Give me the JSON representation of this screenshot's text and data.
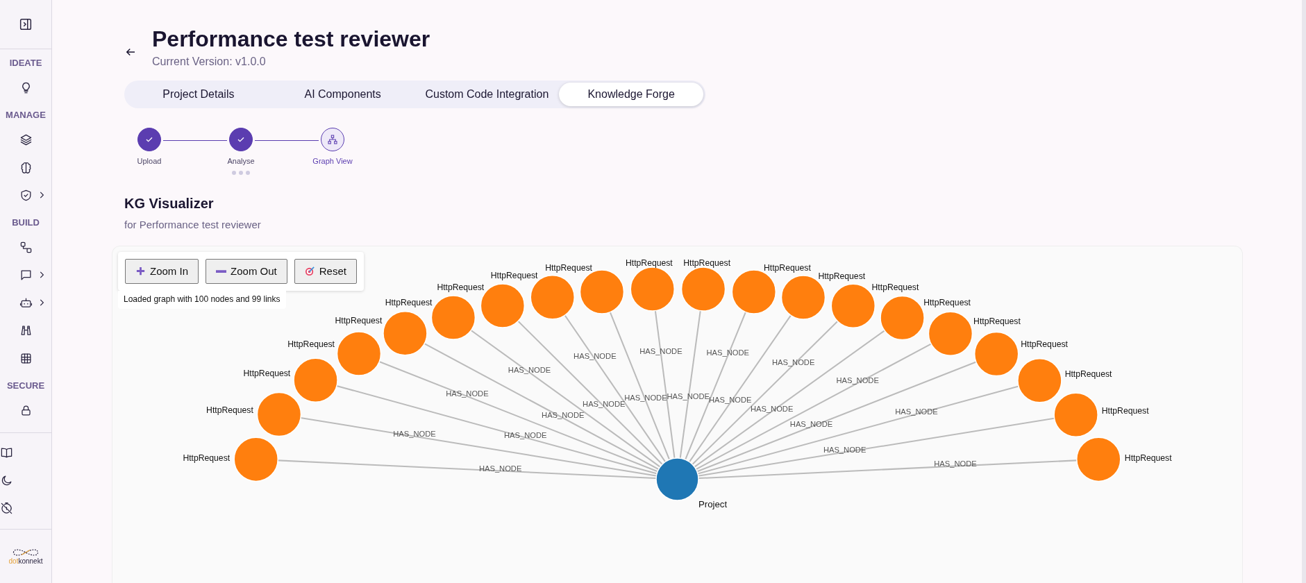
{
  "sidebar": {
    "sections": [
      {
        "label": "IDEATE",
        "items": [
          {
            "kind": "bulb",
            "expandable": false
          }
        ]
      },
      {
        "label": "MANAGE",
        "items": [
          {
            "kind": "layers",
            "expandable": false
          },
          {
            "kind": "brain",
            "expandable": false
          },
          {
            "kind": "shield",
            "expandable": true
          }
        ]
      },
      {
        "label": "BUILD",
        "items": [
          {
            "kind": "nodes",
            "expandable": false
          },
          {
            "kind": "chat",
            "expandable": true
          },
          {
            "kind": "robot",
            "expandable": true
          },
          {
            "kind": "binoculars",
            "expandable": false
          },
          {
            "kind": "grid",
            "expandable": false
          }
        ]
      },
      {
        "label": "SECURE",
        "items": [
          {
            "kind": "lock",
            "expandable": false
          }
        ]
      }
    ],
    "bottom_items": [
      {
        "kind": "book"
      },
      {
        "kind": "moon"
      },
      {
        "kind": "timer-off"
      }
    ],
    "logo": {
      "part_1": "dot",
      "part_2": "konnekt"
    }
  },
  "header": {
    "title": "Performance test reviewer",
    "subtitle": "Current Version: v1.0.0"
  },
  "tabs": [
    {
      "label": "Project Details",
      "selected": false
    },
    {
      "label": "AI Components",
      "selected": false
    },
    {
      "label": "Custom Code Integration",
      "selected": false
    },
    {
      "label": "Knowledge Forge",
      "selected": true
    }
  ],
  "stepper": {
    "steps": [
      {
        "label": "Upload",
        "completed": true,
        "loading": false,
        "kind": "check"
      },
      {
        "label": "Analyse",
        "completed": true,
        "loading": true,
        "kind": "check"
      },
      {
        "label": "Graph View",
        "completed": false,
        "loading": false,
        "kind": "graph"
      }
    ]
  },
  "section": {
    "title": "KG Visualizer",
    "subtitle": "for Performance test reviewer"
  },
  "graph": {
    "toolbar": [
      {
        "label": "Zoom In",
        "kind": "plus"
      },
      {
        "label": "Zoom Out",
        "kind": "minus"
      },
      {
        "label": "Reset",
        "kind": "target"
      }
    ],
    "status": "Loaded graph with 100 nodes and 99 links",
    "root": {
      "label": "Project"
    },
    "children": [
      {
        "label": "HttpRequest",
        "link_label": "HAS_NODE"
      },
      {
        "label": "HttpRequest",
        "link_label": "HAS_NODE"
      },
      {
        "label": "HttpRequest",
        "link_label": "HAS_NODE"
      },
      {
        "label": "HttpRequest",
        "link_label": "HAS_NODE"
      },
      {
        "label": "HttpRequest",
        "link_label": "HAS_NODE"
      },
      {
        "label": "HttpRequest",
        "link_label": "HAS_NODE"
      },
      {
        "label": "HttpRequest",
        "link_label": "HAS_NODE"
      },
      {
        "label": "HttpRequest",
        "link_label": "HAS_NODE"
      },
      {
        "label": "HttpRequest",
        "link_label": "HAS_NODE"
      },
      {
        "label": "HttpRequest",
        "link_label": "HAS_NODE"
      },
      {
        "label": "HttpRequest",
        "link_label": "HAS_NODE"
      },
      {
        "label": "HttpRequest",
        "link_label": "HAS_NODE"
      },
      {
        "label": "HttpRequest",
        "link_label": "HAS_NODE"
      },
      {
        "label": "HttpRequest",
        "link_label": "HAS_NODE"
      },
      {
        "label": "HttpRequest",
        "link_label": "HAS_NODE"
      },
      {
        "label": "HttpRequest",
        "link_label": "HAS_NODE"
      },
      {
        "label": "HttpRequest",
        "link_label": "HAS_NODE"
      },
      {
        "label": "HttpRequest",
        "link_label": "HAS_NODE"
      },
      {
        "label": "HttpRequest",
        "link_label": "HAS_NODE"
      },
      {
        "label": "HttpRequest",
        "link_label": "HAS_NODE"
      }
    ]
  }
}
